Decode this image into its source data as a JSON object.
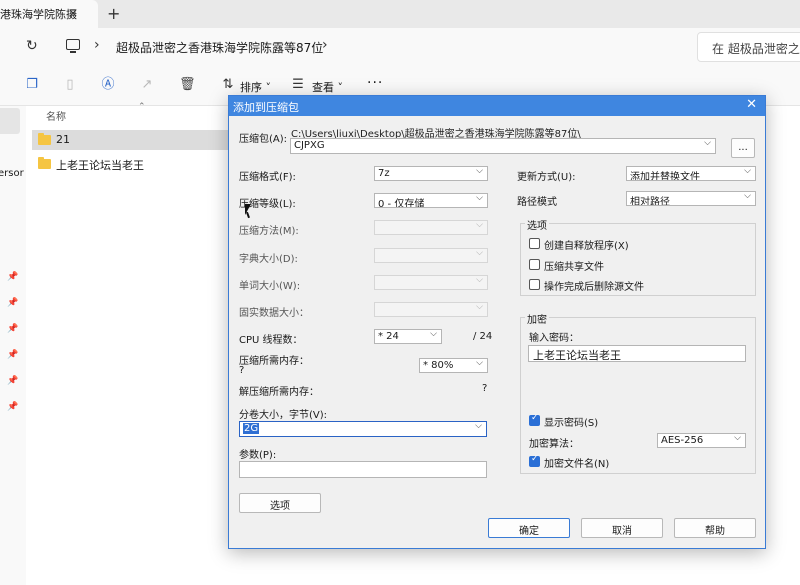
{
  "explorer": {
    "tab_title": "港珠海学院陈摄",
    "tab_close": "×",
    "tab_new": "+",
    "breadcrumb": "超极品泄密之香港珠海学院陈露等87位",
    "search_placeholder": "在 超极品泄密之",
    "toolbar": {
      "sort_label": "排序",
      "view_label": "查看",
      "more": "···"
    },
    "column_name": "名称",
    "nav_fragment": "ersor",
    "files": [
      {
        "name": "21"
      },
      {
        "name": "上老王论坛当老王"
      }
    ]
  },
  "dialog": {
    "title": "添加到压缩包",
    "archive_label": "压缩包(A):",
    "archive_path": "C:\\Users\\liuxi\\Desktop\\超极品泄密之香港珠海学院陈露等87位\\",
    "archive_name": "CJPXG",
    "browse_label": "...",
    "format_label": "压缩格式(F):",
    "format_value": "7z",
    "level_label": "压缩等级(L):",
    "level_value": "0 - 仅存储",
    "method_label": "压缩方法(M):",
    "dict_label": "字典大小(D):",
    "word_label": "单词大小(W):",
    "solid_label": "固实数据大小：",
    "cpu_label": "CPU 线程数：",
    "cpu_value": "* 24",
    "cpu_total": "/ 24",
    "mem_label": "压缩所需内存：",
    "mem_unknown": "?",
    "mem_value": "* 80%",
    "decomp_mem_label": "解压缩所需内存：",
    "decomp_mem_value": "?",
    "split_label": "分卷大小，字节(V):",
    "split_value": "2G",
    "params_label": "参数(P):",
    "params_value": "",
    "options_button": "选项",
    "update_label": "更新方式(U):",
    "update_value": "添加并替换文件",
    "path_mode_label": "路径模式",
    "path_mode_value": "相对路径",
    "options_group": "选项",
    "opt_sfx": "创建自释放程序(X)",
    "opt_shared": "压缩共享文件",
    "opt_delete": "操作完成后删除源文件",
    "encrypt_group": "加密",
    "password_label": "输入密码：",
    "password_value": "上老王论坛当老王",
    "show_password": "显示密码(S)",
    "enc_method_label": "加密算法：",
    "enc_method_value": "AES-256",
    "encrypt_names": "加密文件名(N)",
    "ok": "确定",
    "cancel": "取消",
    "help": "帮助",
    "close": "✕"
  },
  "colors": {
    "accent": "#3f86e0",
    "selection": "#2f6fd3",
    "folder": "#f5c542"
  }
}
